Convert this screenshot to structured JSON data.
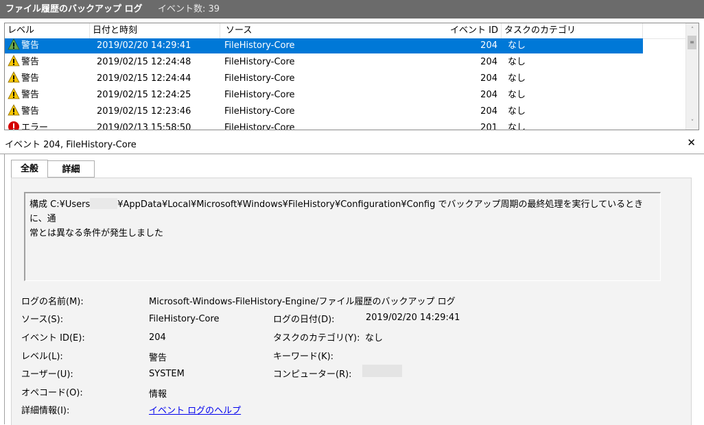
{
  "title": {
    "log_name": "ファイル履歴のバックアップ ログ",
    "event_count": "イベント数: 39"
  },
  "columns": {
    "level": "レベル",
    "datetime": "日付と時刻",
    "source": "ソース",
    "event_id": "イベント ID",
    "category": "タスクのカテゴリ"
  },
  "events": [
    {
      "level": "警告",
      "datetime": "2019/02/20 14:29:41",
      "source": "FileHistory-Core",
      "event_id": "204",
      "category": "なし",
      "icon": "warning-icon",
      "selected": true
    },
    {
      "level": "警告",
      "datetime": "2019/02/15 12:24:48",
      "source": "FileHistory-Core",
      "event_id": "204",
      "category": "なし",
      "icon": "warning-icon"
    },
    {
      "level": "警告",
      "datetime": "2019/02/15 12:24:44",
      "source": "FileHistory-Core",
      "event_id": "204",
      "category": "なし",
      "icon": "warning-icon"
    },
    {
      "level": "警告",
      "datetime": "2019/02/15 12:24:25",
      "source": "FileHistory-Core",
      "event_id": "204",
      "category": "なし",
      "icon": "warning-icon"
    },
    {
      "level": "警告",
      "datetime": "2019/02/15 12:23:46",
      "source": "FileHistory-Core",
      "event_id": "204",
      "category": "なし",
      "icon": "warning-icon"
    },
    {
      "level": "エラー",
      "datetime": "2019/02/13 15:58:50",
      "source": "FileHistory-Core",
      "event_id": "201",
      "category": "なし",
      "icon": "error-icon"
    }
  ],
  "detail": {
    "title": "イベント 204, FileHistory-Core",
    "tabs": {
      "general": "全般",
      "details": "詳細"
    },
    "message_part1": "構成 C:¥Users",
    "message_part2": "¥AppData¥Local¥Microsoft¥Windows¥FileHistory¥Configuration¥Config でバックアップ周期の最終処理を実行しているときに、通",
    "message_line2": "常とは異なる条件が発生しました",
    "labels": {
      "log_name": "ログの名前(M):",
      "source": "ソース(S):",
      "event_id": "イベント ID(E):",
      "level": "レベル(L):",
      "user": "ユーザー(U):",
      "opcode": "オペコード(O):",
      "more_info": "詳細情報(I):",
      "logged": "ログの日付(D):",
      "task_category": "タスクのカテゴリ(Y):",
      "keywords": "キーワード(K):",
      "computer": "コンピューター(R):"
    },
    "values": {
      "log_name": "Microsoft-Windows-FileHistory-Engine/ファイル履歴のバックアップ ログ",
      "source": "FileHistory-Core",
      "event_id": "204",
      "level": "警告",
      "user": "SYSTEM",
      "opcode": "情報",
      "more_info_link": "イベント ログのヘルプ",
      "logged": "2019/02/20 14:29:41",
      "task_category": "なし"
    }
  },
  "colors": {
    "selection": "#0078d7",
    "titlebar": "#6b6b6b",
    "link": "#0000ee"
  }
}
